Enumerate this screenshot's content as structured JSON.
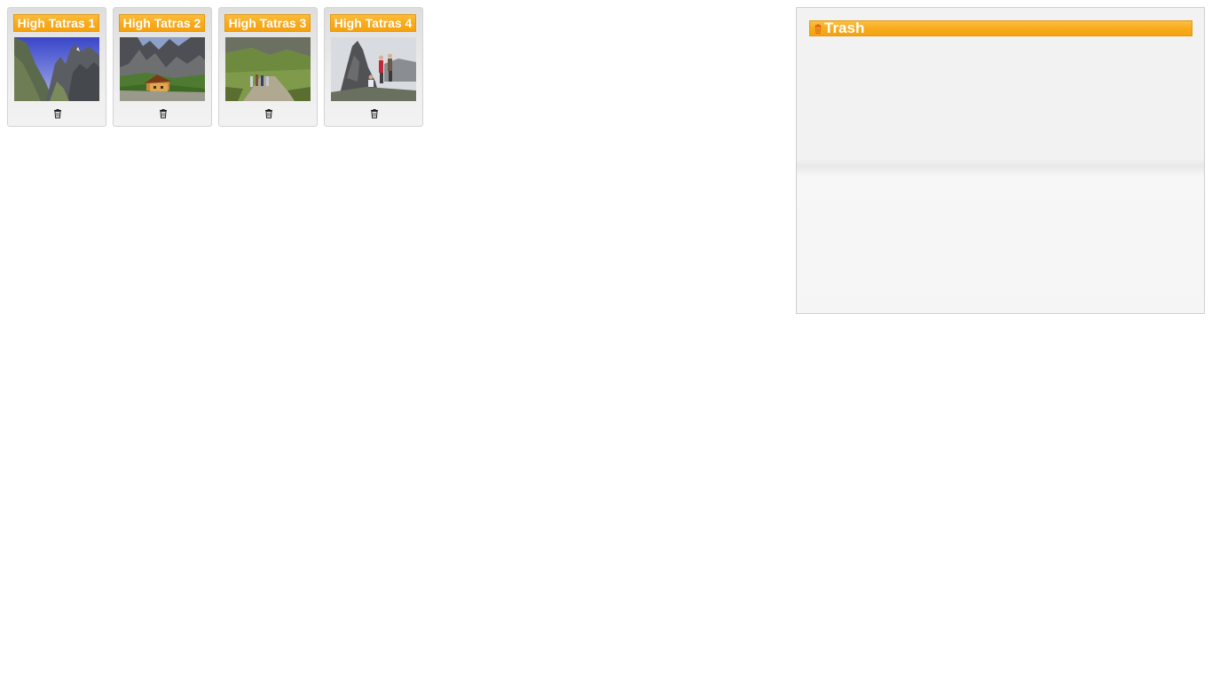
{
  "gallery": {
    "items": [
      {
        "title": "High Tatras 1",
        "image": "mountain-valley-photo",
        "delete_icon": "trash-icon"
      },
      {
        "title": "High Tatras 2",
        "image": "mountain-chalet-photo",
        "delete_icon": "trash-icon"
      },
      {
        "title": "High Tatras 3",
        "image": "hikers-on-trail-photo",
        "delete_icon": "trash-icon"
      },
      {
        "title": "High Tatras 4",
        "image": "climbers-on-peak-photo",
        "delete_icon": "trash-icon"
      }
    ]
  },
  "trash": {
    "title": "Trash",
    "icon": "trash-icon"
  },
  "colors": {
    "accent": "#f8a91a",
    "accent_border": "#e29a10",
    "card_background": "#e9e9e9",
    "panel_background": "#f2f2f2"
  }
}
